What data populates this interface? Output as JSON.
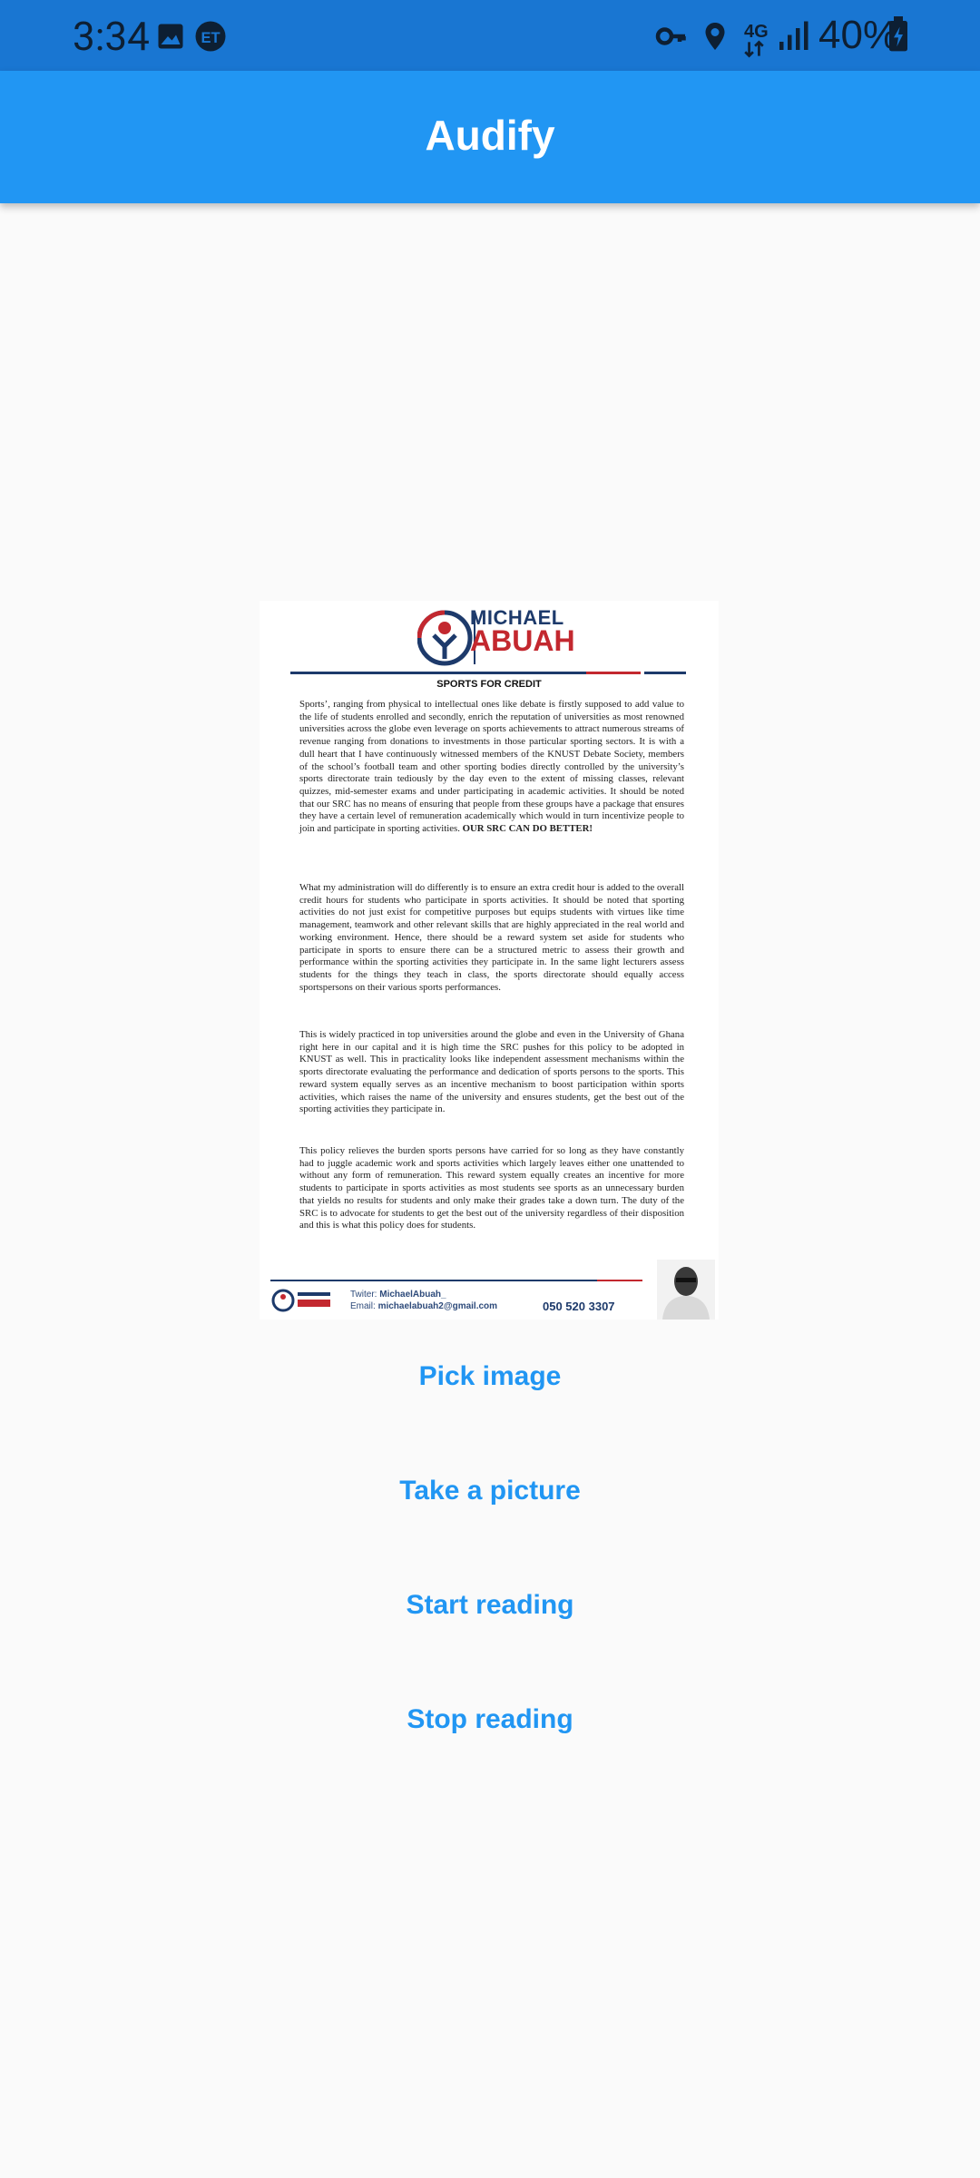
{
  "status_bar": {
    "time": "3:34",
    "battery": "40%",
    "network": "4G"
  },
  "app": {
    "title": "Audify"
  },
  "document": {
    "brand_first": "MICHAEL",
    "brand_last": "ABUAH",
    "title": "SPORTS FOR CREDIT",
    "paragraphs": [
      "Sports’, ranging from physical to intellectual ones like debate is firstly supposed to add value to the life of students enrolled and secondly, enrich the reputation of universities as most renowned universities across the globe even leverage on sports achievements to attract numerous streams of revenue ranging from donations to investments in those particular sporting sectors. It is with a dull heart that I have continuously witnessed members of the KNUST Debate Society, members of the school’s football team and other sporting bodies directly controlled by the university’s sports directorate train tediously by the day even to the extent of missing classes, relevant quizzes, mid-semester exams and under participating in academic activities. It should be noted that our SRC has no means of ensuring that people from these groups have a package that ensures they have a certain level of remuneration academically which would in turn incentivize people to join and participate in sporting activities.",
      "What my administration will do differently is to ensure an extra credit hour is added to the overall credit hours for students who participate in sports activities. It should be noted that sporting activities do not just exist for competitive purposes but equips students with virtues like time management, teamwork and other relevant skills that are highly appreciated in the real world and working environment. Hence, there should be a reward system set aside for students who participate in sports to ensure there can be a structured metric to assess their growth and performance within the sporting activities they participate in. In the same light lecturers assess students for the things they teach in class, the sports directorate should equally access sportspersons on their various sports performances.",
      "This is widely practiced in top universities around the globe and even in the University of Ghana right here in our capital and it is high time the SRC pushes for this policy to be adopted in KNUST as well. This in practicality looks like independent assessment mechanisms within the sports directorate evaluating the performance and dedication of sports persons to the sports. This reward system equally serves as an incentive mechanism to boost participation within sports activities, which raises the name of the university and ensures students, get the best out of the sporting activities they participate in.",
      "This policy relieves the burden sports persons have carried for so long as they have constantly had to juggle academic work and sports activities which largely leaves either one unattended to without any form of remuneration. This reward system equally creates an incentive for more students to participate in sports activities as most students see sports as an unnecessary burden that yields no results for students and only make their grades take a down turn. The duty of the SRC is to advocate for students to get the best out of the university regardless of their disposition and this is what this policy does for students."
    ],
    "emphasis": "OUR SRC CAN DO BETTER!",
    "twitter_label": "Twiter:",
    "twitter": "MichaelAbuah_",
    "email_label": "Email:",
    "email": "michaelabuah2@gmail.com",
    "phone": "050 520 3307"
  },
  "buttons": {
    "pick": "Pick image",
    "take": "Take a picture",
    "start": "Start reading",
    "stop": "Stop reading"
  },
  "colors": {
    "status_bar": "#1976d2",
    "app_bar": "#2196f3",
    "accent": "#2196f3",
    "background": "#fafafa"
  }
}
